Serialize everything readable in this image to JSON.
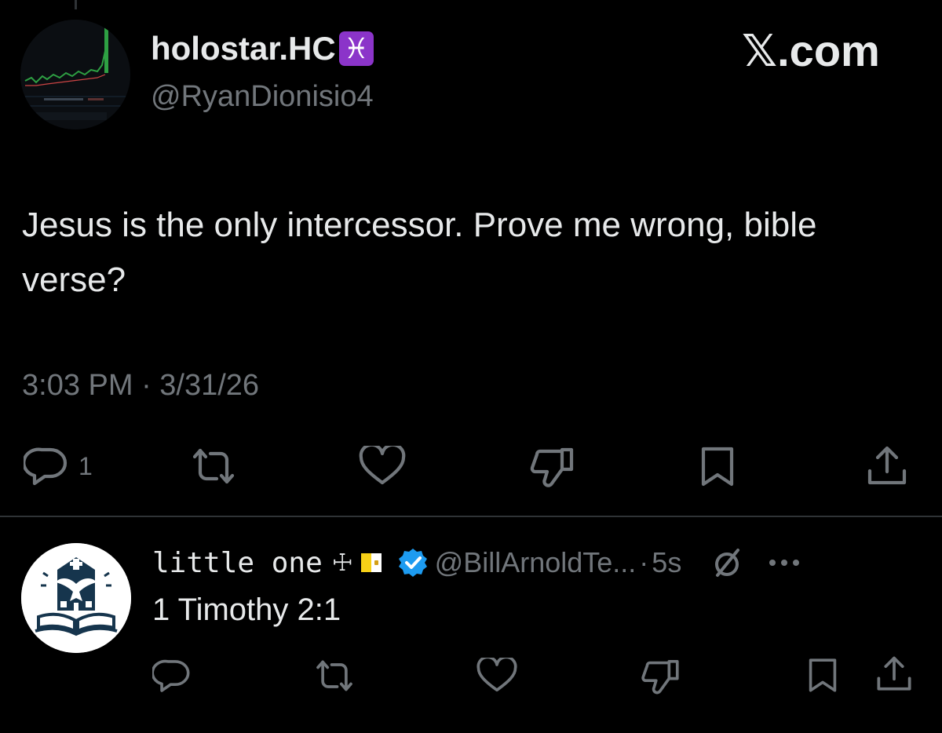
{
  "post": {
    "display_name": "holostar.HC",
    "name_emoji": "♓",
    "handle": "@RyanDionisio4",
    "text": "Jesus is the only intercessor. Prove me wrong, bible verse?",
    "timestamp": "3:03 PM · 3/31/26",
    "reply_count": "1"
  },
  "brand": {
    "label": "𝕏.com"
  },
  "reply": {
    "display_name": "little one",
    "name_emojis": "☩",
    "verified": true,
    "handle": "@BillArnoldTe...",
    "separator": "·",
    "time": "5s",
    "text": "1 Timothy 2:1"
  },
  "colors": {
    "background": "#000000",
    "primary_text": "#e7e9ea",
    "secondary_text": "#71767b",
    "divider": "#2f3336",
    "verified_blue": "#1d9bf0",
    "pisces_purple": "#8b34c9"
  },
  "icons": {
    "post_actions": [
      "reply-icon",
      "repost-icon",
      "like-icon",
      "dislike-icon",
      "bookmark-icon",
      "share-icon"
    ],
    "reply_extras": [
      "community-notes-icon",
      "more-icon"
    ]
  }
}
